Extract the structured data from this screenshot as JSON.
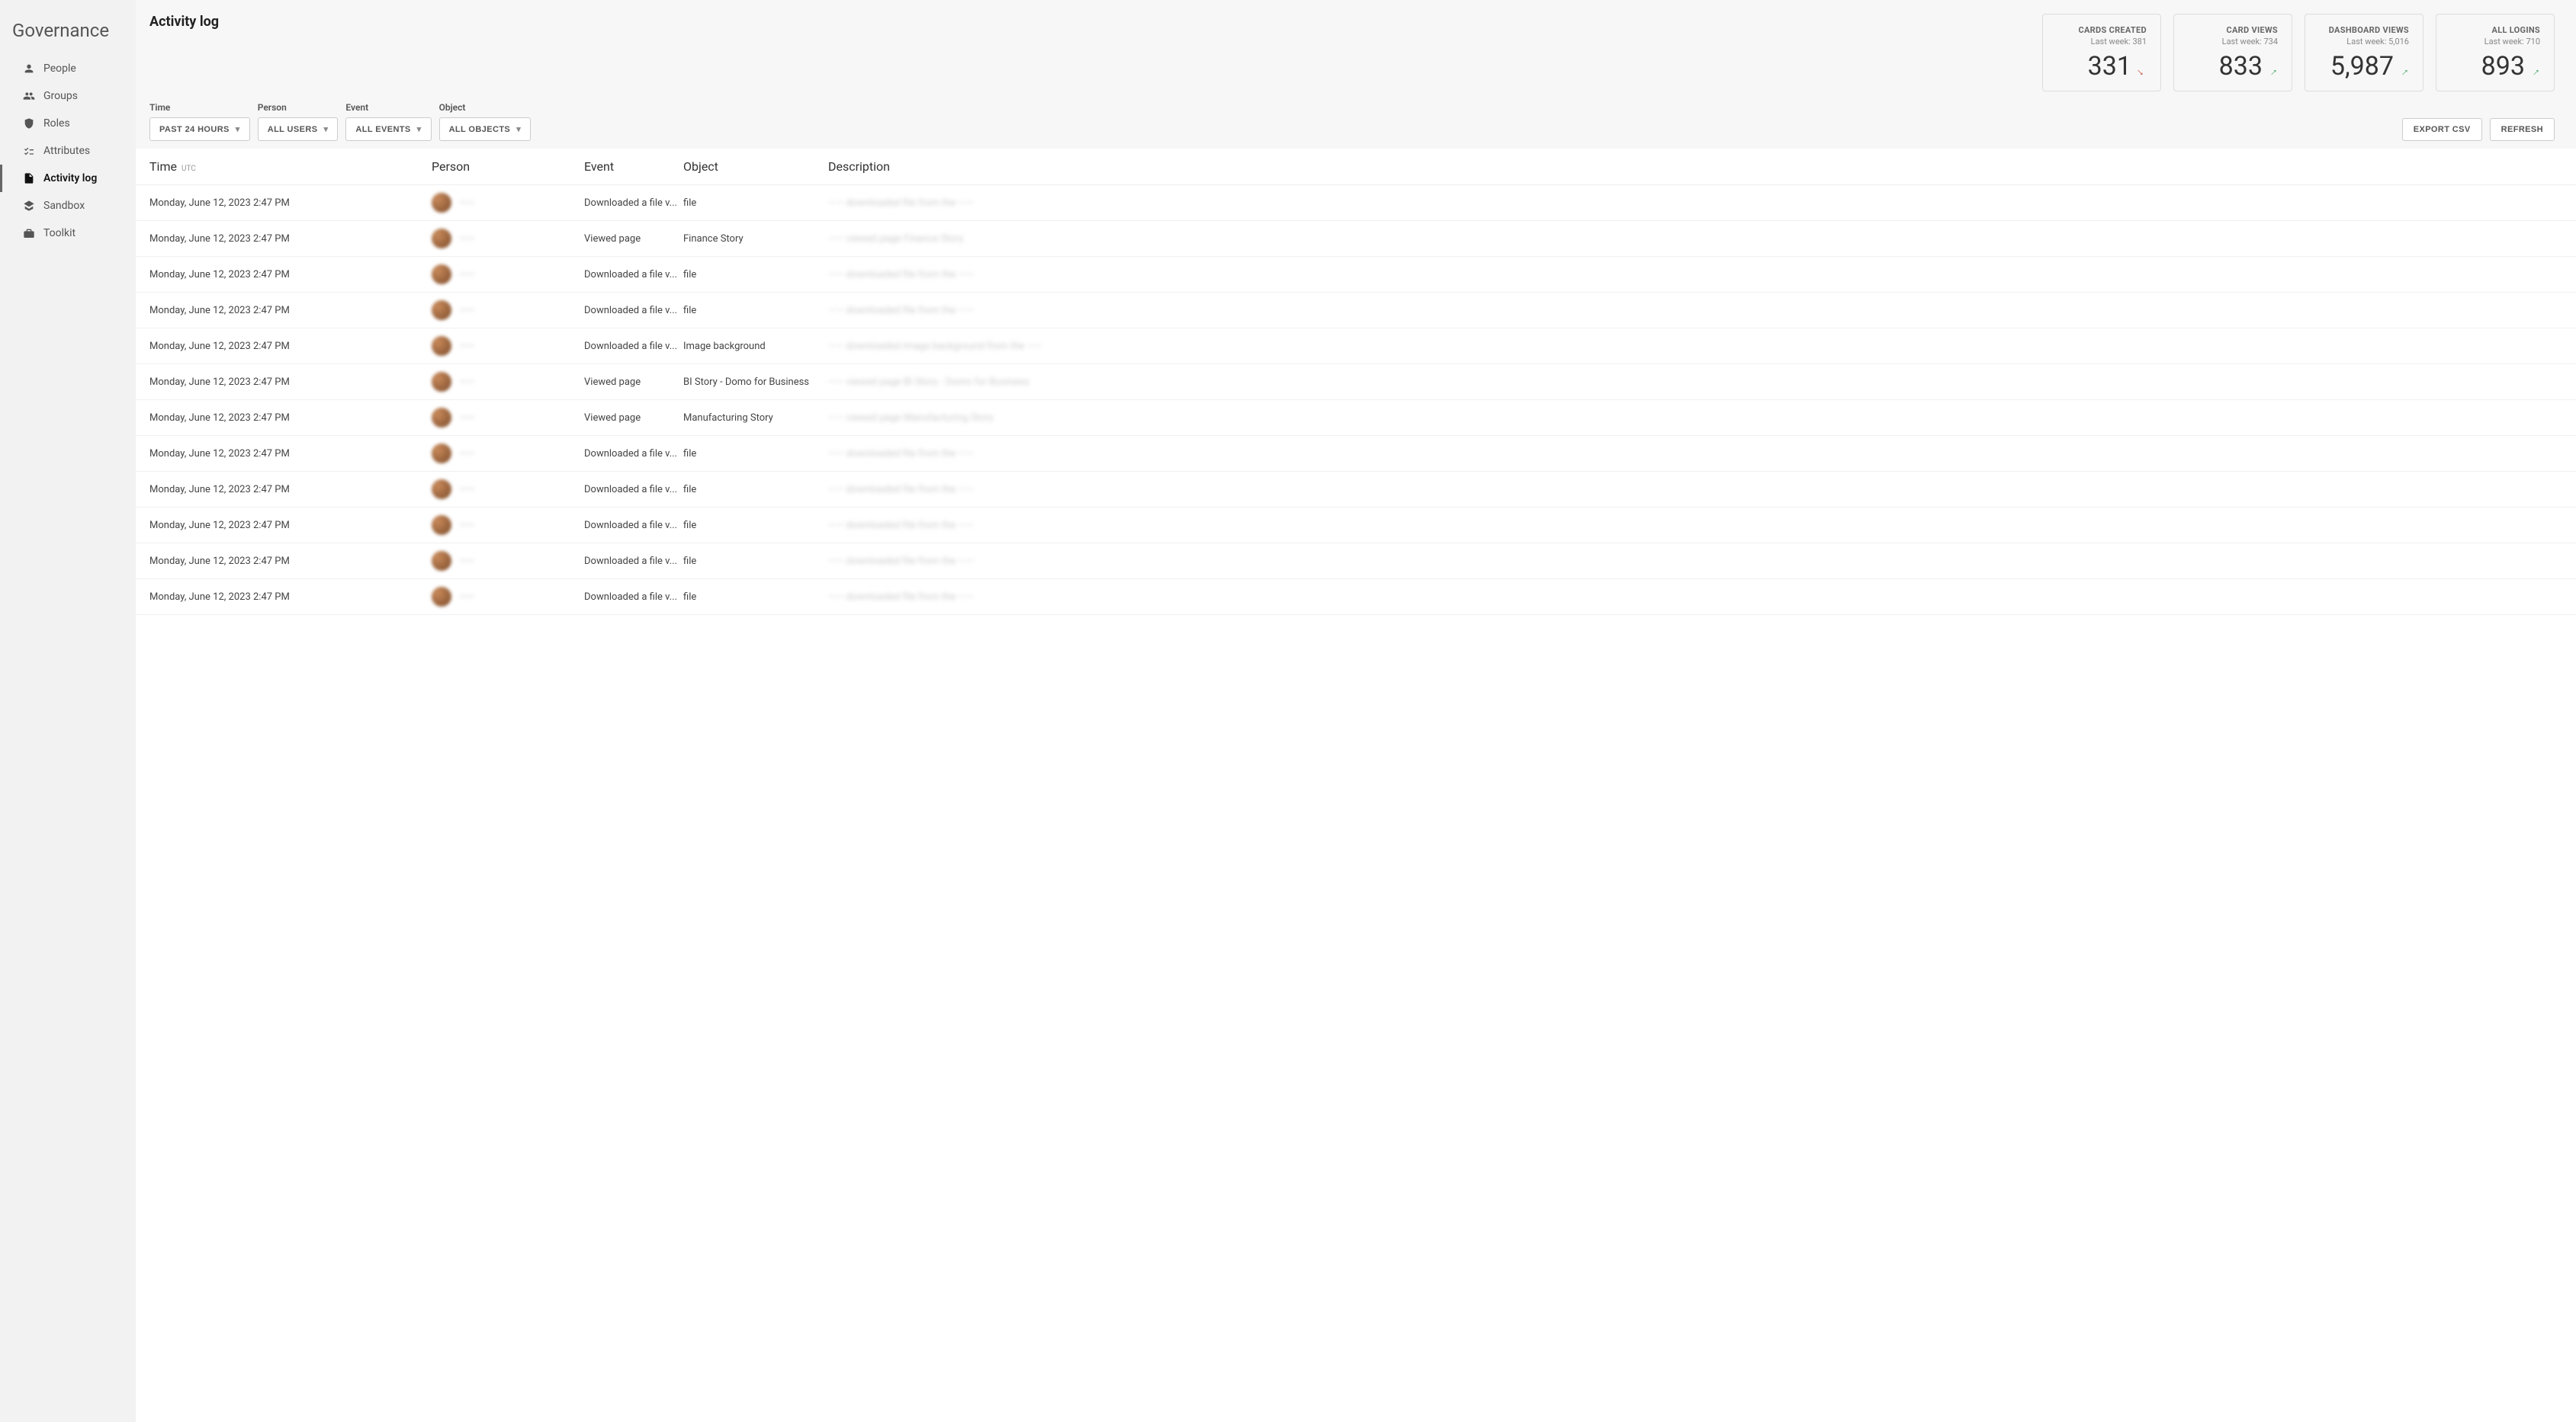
{
  "sidebar": {
    "title": "Governance",
    "items": [
      {
        "label": "People",
        "icon": "person-icon"
      },
      {
        "label": "Groups",
        "icon": "groups-icon"
      },
      {
        "label": "Roles",
        "icon": "shield-icon"
      },
      {
        "label": "Attributes",
        "icon": "checklist-icon"
      },
      {
        "label": "Activity log",
        "icon": "file-icon",
        "active": true
      },
      {
        "label": "Sandbox",
        "icon": "sandbox-icon"
      },
      {
        "label": "Toolkit",
        "icon": "toolbox-icon"
      }
    ]
  },
  "header": {
    "title": "Activity log"
  },
  "stats": [
    {
      "label": "CARDS CREATED",
      "sub": "Last week: 381",
      "value": "331",
      "trend": "down"
    },
    {
      "label": "CARD VIEWS",
      "sub": "Last week: 734",
      "value": "833",
      "trend": "up"
    },
    {
      "label": "DASHBOARD VIEWS",
      "sub": "Last week: 5,016",
      "value": "5,987",
      "trend": "up"
    },
    {
      "label": "ALL LOGINS",
      "sub": "Last week: 710",
      "value": "893",
      "trend": "up"
    }
  ],
  "filters": {
    "time": {
      "label": "Time",
      "value": "PAST 24 HOURS"
    },
    "person": {
      "label": "Person",
      "value": "ALL USERS"
    },
    "event": {
      "label": "Event",
      "value": "ALL EVENTS"
    },
    "object": {
      "label": "Object",
      "value": "ALL OBJECTS"
    }
  },
  "actions": {
    "export": "EXPORT CSV",
    "refresh": "REFRESH"
  },
  "table": {
    "columns": {
      "time": "Time",
      "tz": "UTC",
      "person": "Person",
      "event": "Event",
      "object": "Object",
      "desc": "Description"
    },
    "rows": [
      {
        "time": "Monday, June 12, 2023 2:47 PM",
        "person": "——",
        "event": "Downloaded a file v...",
        "object": "file",
        "desc": "—— downloaded file from the ——"
      },
      {
        "time": "Monday, June 12, 2023 2:47 PM",
        "person": "——",
        "event": "Viewed page",
        "object": "Finance Story",
        "desc": "—— viewed page Finance Story"
      },
      {
        "time": "Monday, June 12, 2023 2:47 PM",
        "person": "——",
        "event": "Downloaded a file v...",
        "object": "file",
        "desc": "—— downloaded file from the ——"
      },
      {
        "time": "Monday, June 12, 2023 2:47 PM",
        "person": "——",
        "event": "Downloaded a file v...",
        "object": "file",
        "desc": "—— downloaded file from the ——"
      },
      {
        "time": "Monday, June 12, 2023 2:47 PM",
        "person": "——",
        "event": "Downloaded a file v...",
        "object": "Image background",
        "desc": "—— downloaded image background from the ——"
      },
      {
        "time": "Monday, June 12, 2023 2:47 PM",
        "person": "——",
        "event": "Viewed page",
        "object": "BI Story - Domo for Business",
        "desc": "—— viewed page BI Story - Domo for Business"
      },
      {
        "time": "Monday, June 12, 2023 2:47 PM",
        "person": "——",
        "event": "Viewed page",
        "object": "Manufacturing Story",
        "desc": "—— viewed page Manufacturing Story"
      },
      {
        "time": "Monday, June 12, 2023 2:47 PM",
        "person": "——",
        "event": "Downloaded a file v...",
        "object": "file",
        "desc": "—— downloaded file from the ——"
      },
      {
        "time": "Monday, June 12, 2023 2:47 PM",
        "person": "——",
        "event": "Downloaded a file v...",
        "object": "file",
        "desc": "—— downloaded file from the ——"
      },
      {
        "time": "Monday, June 12, 2023 2:47 PM",
        "person": "——",
        "event": "Downloaded a file v...",
        "object": "file",
        "desc": "—— downloaded file from the ——"
      },
      {
        "time": "Monday, June 12, 2023 2:47 PM",
        "person": "——",
        "event": "Downloaded a file v...",
        "object": "file",
        "desc": "—— downloaded file from the ——"
      },
      {
        "time": "Monday, June 12, 2023 2:47 PM",
        "person": "——",
        "event": "Downloaded a file v...",
        "object": "file",
        "desc": "—— downloaded file from the ——"
      }
    ]
  }
}
